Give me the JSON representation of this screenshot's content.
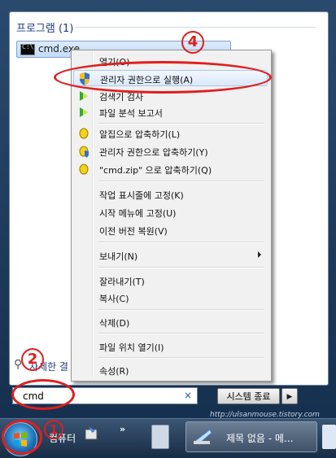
{
  "programs_section": {
    "header": "프로그램 (1)",
    "item_label": "cmd.exe",
    "see_more": "자세한 결"
  },
  "context_menu": {
    "items": [
      {
        "label": "열기(O)",
        "icon": "none"
      },
      {
        "label": "관리자 권한으로 실행(A)",
        "icon": "uac-shield-icon"
      },
      {
        "label": "검색기 검사",
        "icon": "antivirus-icon"
      },
      {
        "label": "파일 분석 보고서",
        "icon": "antivirus-icon"
      },
      {
        "label": "알집으로 압축하기(L)",
        "icon": "alzip-icon"
      },
      {
        "label": "관리자 권한으로 압축하기(Y)",
        "icon": "alzip-shield-icon"
      },
      {
        "label": "\"cmd.zip\" 으로 압축하기(Q)",
        "icon": "alzip-icon"
      },
      {
        "label": "작업 표시줄에 고정(K)",
        "icon": "none"
      },
      {
        "label": "시작 메뉴에 고정(U)",
        "icon": "none"
      },
      {
        "label": "이전 버전 복원(V)",
        "icon": "none"
      },
      {
        "label": "보내기(N)",
        "icon": "none"
      },
      {
        "label": "잘라내기(T)",
        "icon": "none"
      },
      {
        "label": "복사(C)",
        "icon": "none"
      },
      {
        "label": "삭제(D)",
        "icon": "none"
      },
      {
        "label": "파일 위치 열기(I)",
        "icon": "none"
      },
      {
        "label": "속성(R)",
        "icon": "none"
      }
    ]
  },
  "search": {
    "value": "cmd",
    "clear_glyph": "×"
  },
  "shutdown": {
    "label": "시스템 종료",
    "arrow_glyph": "▶"
  },
  "taskbar": {
    "computer_label": "컴퓨터",
    "chevron": "»",
    "app_label": "제목 없음 - 메..."
  },
  "watermark": "http://ulsanmouse.tistory.com",
  "annotations": {
    "n1": "1",
    "n2": "2",
    "n4": "4",
    "color": "#e01e1e"
  }
}
